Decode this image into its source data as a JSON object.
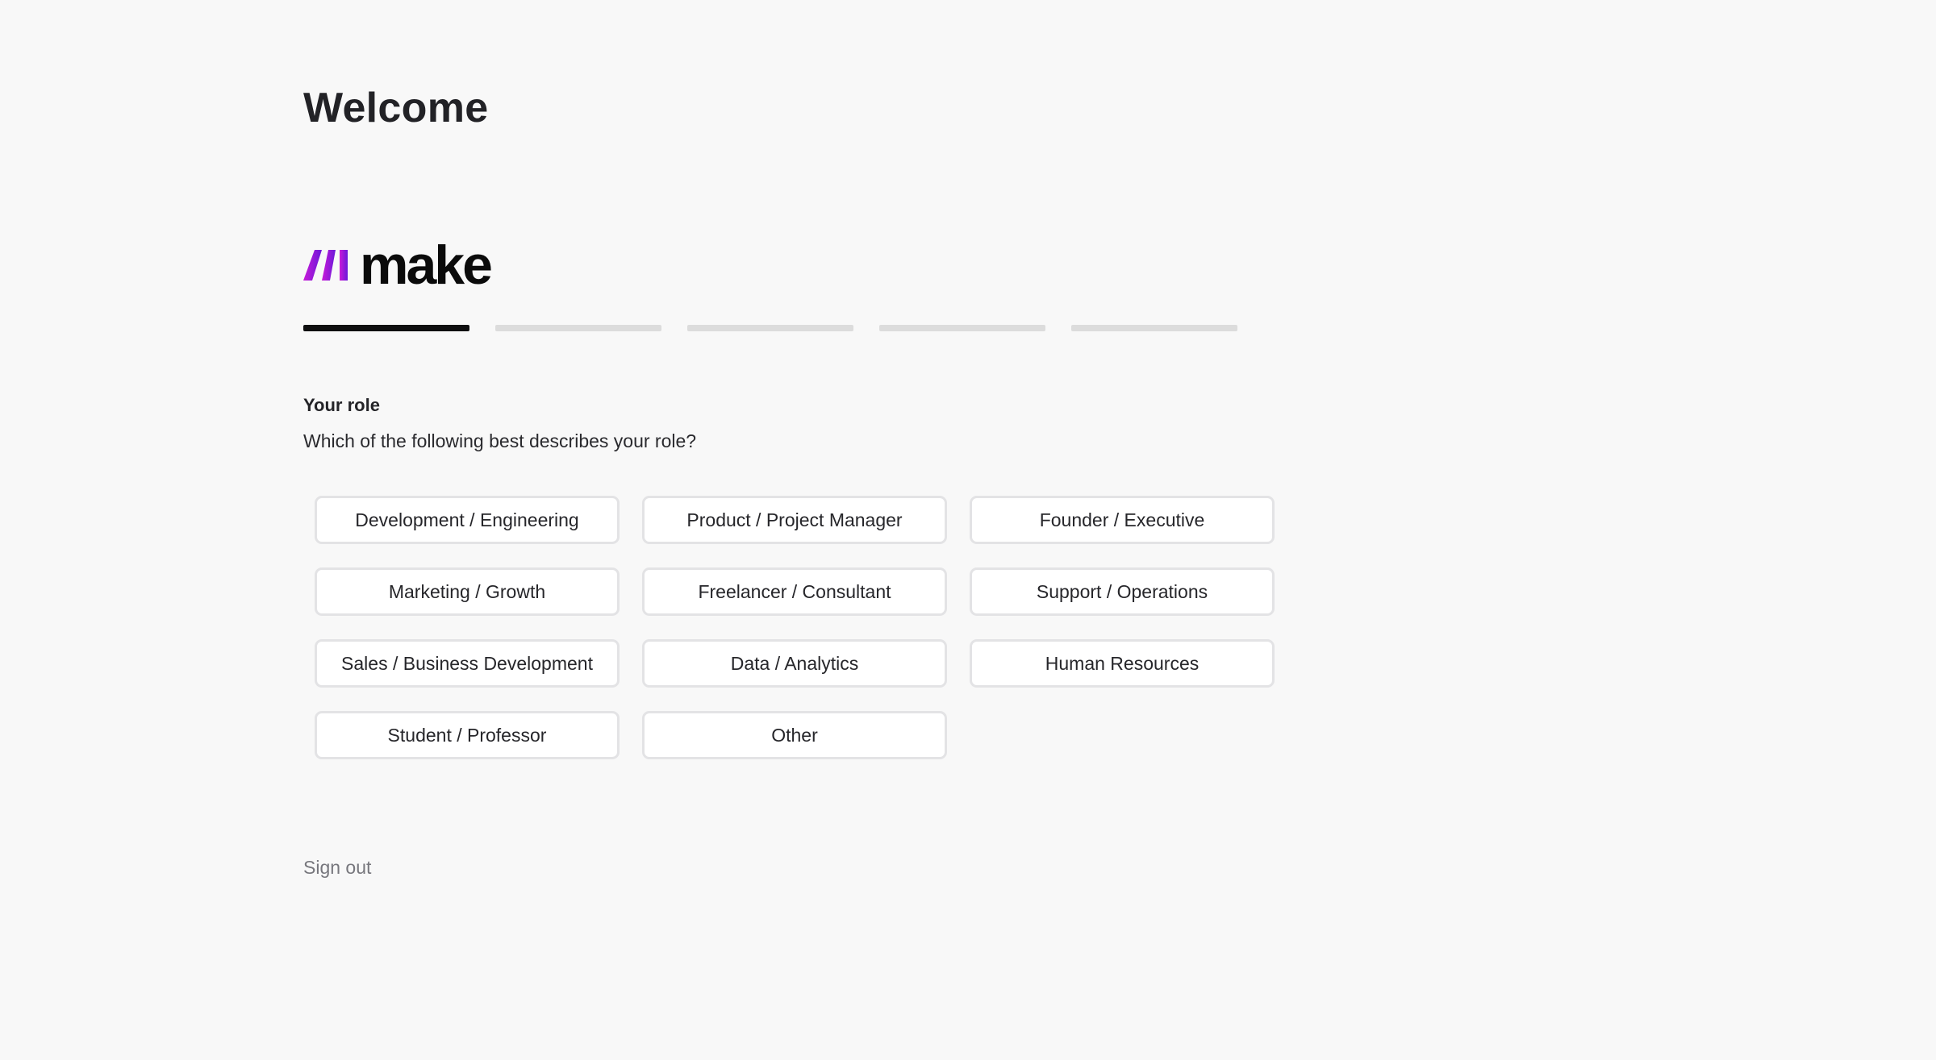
{
  "header": {
    "title": "Welcome"
  },
  "brand": {
    "name": "make",
    "gradient_start": "#c91bd8",
    "gradient_end": "#6a18d9"
  },
  "progress": {
    "total_steps": 5,
    "current_step": 1
  },
  "form": {
    "section_title": "Your role",
    "question": "Which of the following best describes your role?",
    "options": [
      "Development / Engineering",
      "Product / Project Manager",
      "Founder / Executive",
      "Marketing / Growth",
      "Freelancer / Consultant",
      "Support / Operations",
      "Sales / Business Development",
      "Data / Analytics",
      "Human Resources",
      "Student / Professor",
      "Other"
    ]
  },
  "footer": {
    "sign_out_label": "Sign out"
  }
}
